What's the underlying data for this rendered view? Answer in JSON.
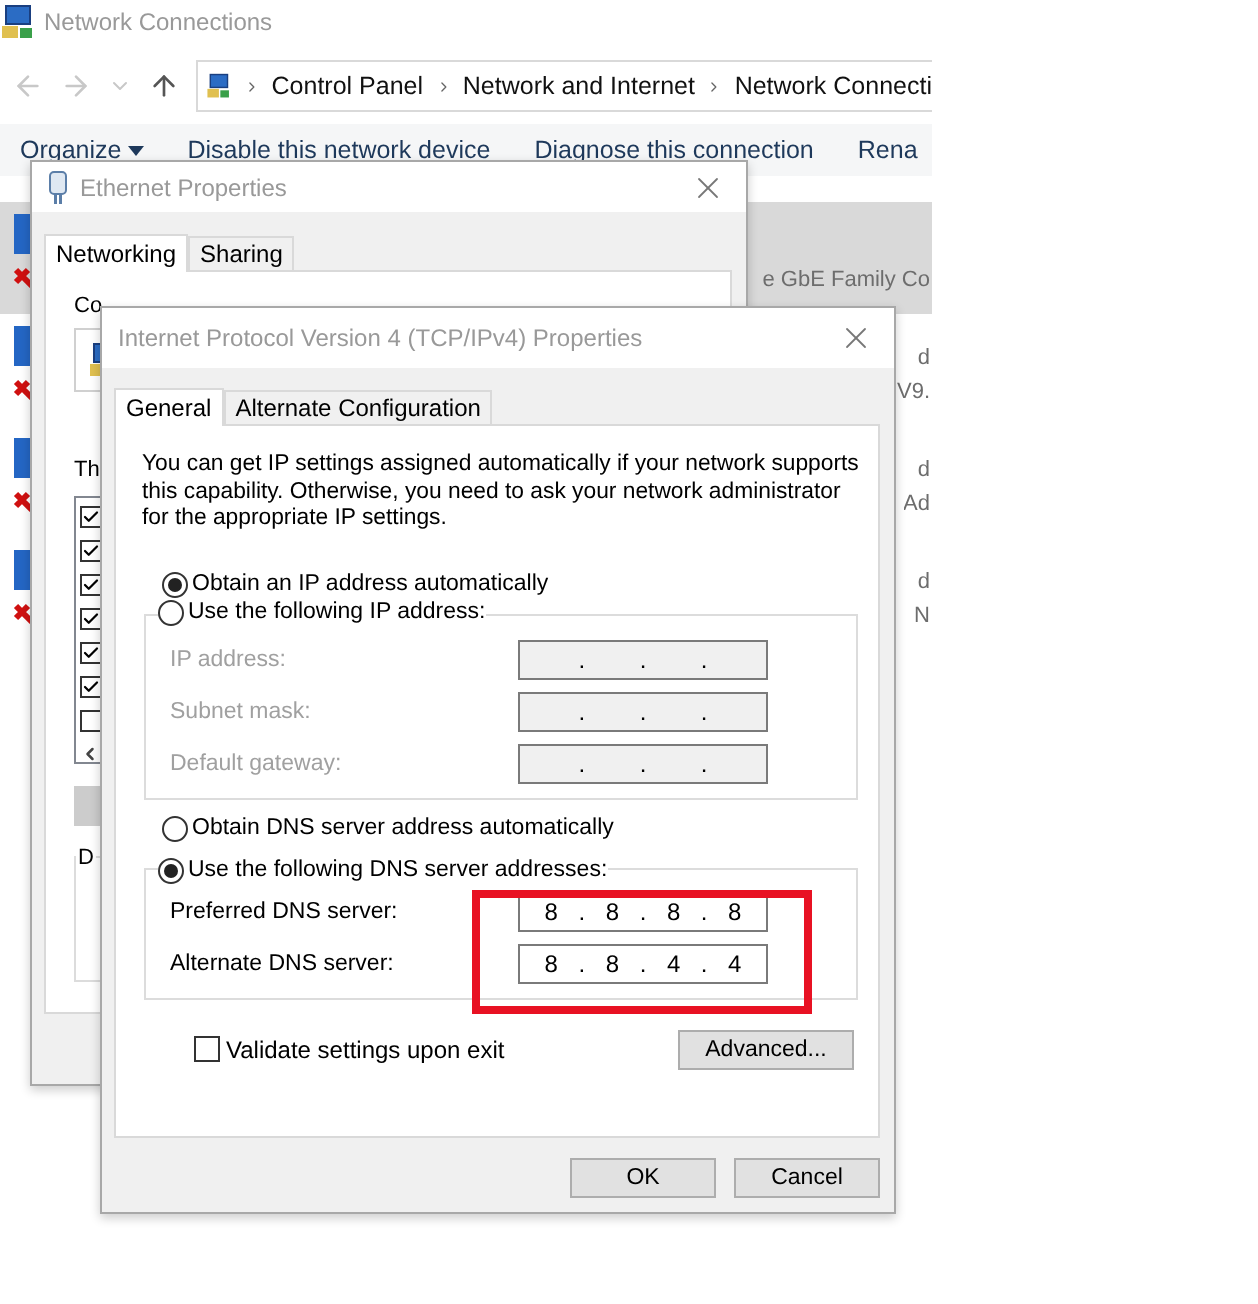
{
  "explorer": {
    "title": "Network Connections",
    "breadcrumbs": [
      "Control Panel",
      "Network and Internet",
      "Network Connecti"
    ],
    "toolbar": [
      {
        "label": "Organize",
        "kind": "menu"
      },
      {
        "label": "Disable this network device",
        "kind": "command"
      },
      {
        "label": "Diagnose this connection",
        "kind": "command"
      },
      {
        "label": "Rena",
        "kind": "command"
      }
    ],
    "adapters": [
      {
        "selected": true,
        "lines": [
          "e GbE Family Co"
        ]
      },
      {
        "selected": false,
        "lines": [
          "d",
          "V9."
        ]
      },
      {
        "selected": false,
        "lines": [
          "d",
          "Ad"
        ]
      },
      {
        "selected": false,
        "lines": [
          "d",
          "N"
        ]
      }
    ]
  },
  "ethernet": {
    "title": "Ethernet Properties",
    "tabs": [
      {
        "label": "Networking",
        "selected": true
      },
      {
        "label": "Sharing",
        "selected": false
      }
    ],
    "connect_label": "Co",
    "items_label": "Th",
    "items": [
      {
        "checked": true
      },
      {
        "checked": true
      },
      {
        "checked": true
      },
      {
        "checked": true
      },
      {
        "checked": true
      },
      {
        "checked": true
      },
      {
        "checked": false
      }
    ],
    "group_label": "D"
  },
  "ipv4": {
    "title": "Internet Protocol Version 4 (TCP/IPv4) Properties",
    "tabs": [
      {
        "label": "General",
        "selected": true
      },
      {
        "label": "Alternate Configuration",
        "selected": false
      }
    ],
    "intro": "You can get IP settings assigned automatically if your network supports this capability. Otherwise, you need to ask your network administrator for the appropriate IP settings.",
    "dot": ".",
    "sections": [
      {
        "auto_option": {
          "label": "Obtain an IP address automatically",
          "selected": true
        },
        "manual_option": {
          "label": "Use the following IP address:",
          "selected": false
        },
        "fields": [
          {
            "label": "IP address:",
            "disabled": true
          },
          {
            "label": "Subnet mask:",
            "disabled": true
          },
          {
            "label": "Default gateway:",
            "disabled": true
          }
        ]
      },
      {
        "auto_option": {
          "label": "Obtain DNS server address automatically",
          "selected": false
        },
        "manual_option": {
          "label": "Use the following DNS server addresses:",
          "selected": true
        },
        "highlighted": true,
        "fields": [
          {
            "label": "Preferred DNS server:",
            "disabled": false,
            "octets": [
              "8",
              "8",
              "8",
              "8"
            ]
          },
          {
            "label": "Alternate DNS server:",
            "disabled": false,
            "octets": [
              "8",
              "8",
              "4",
              "4"
            ]
          }
        ]
      }
    ],
    "validate": {
      "label": "Validate settings upon exit",
      "checked": false
    },
    "advanced": "Advanced...",
    "buttons": [
      "OK",
      "Cancel"
    ]
  }
}
